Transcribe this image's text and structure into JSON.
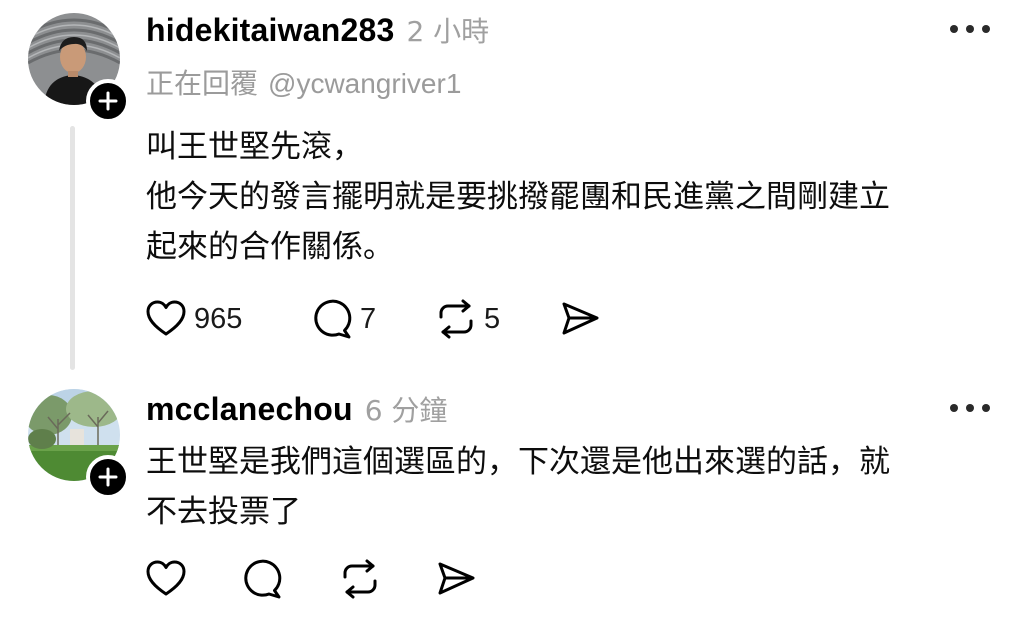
{
  "posts": [
    {
      "username": "hidekitaiwan283",
      "time": "2 小時",
      "reply_prefix": "正在回覆",
      "reply_handle": "@ycwangriver1",
      "body_lines": [
        "叫王世堅先滾，",
        "他今天的發言擺明就是要挑撥罷團和民進黨之間剛建立",
        "起來的合作關係。"
      ],
      "likes": "965",
      "comments": "7",
      "reposts": "5",
      "icons": [
        "heart-icon",
        "comment-icon",
        "repost-icon",
        "share-icon",
        "more-icon",
        "plus-icon"
      ]
    },
    {
      "username": "mcclanechou",
      "time": "6 分鐘",
      "body_lines": [
        "王世堅是我們這個選區的，下次還是他出來選的話，就",
        "不去投票了"
      ],
      "icons": [
        "heart-icon",
        "comment-icon",
        "repost-icon",
        "share-icon",
        "more-icon",
        "plus-icon"
      ]
    }
  ],
  "colors": {
    "text": "#0d0d0d",
    "muted": "#a0a0a0",
    "thread_line": "#e4e4e4",
    "badge": "#000000"
  }
}
